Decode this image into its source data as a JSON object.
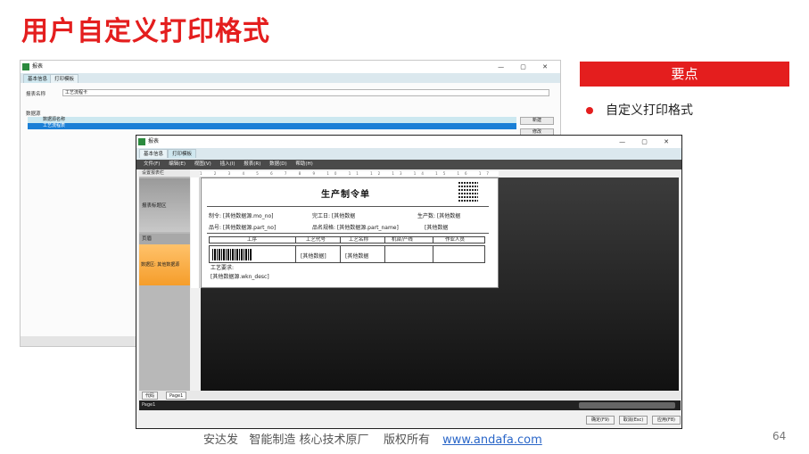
{
  "slide": {
    "title": "用户自定义打印格式",
    "key_points_header": "要点",
    "key_points": [
      "自定义打印格式"
    ],
    "footer": "安达发   智能制造 核心技术原厂    版权所有",
    "footer_link": "www.andafa.com",
    "page_number": "64"
  },
  "back_window": {
    "title": "报表",
    "tabs": [
      "基本信息",
      "打印模板"
    ],
    "report_name_label": "报表名称",
    "report_name_value": "工艺流程卡",
    "datasource_label": "数据源",
    "datasource_column": "数据源名称",
    "datasource_rows": [
      "工艺流程表"
    ],
    "buttons": [
      "新建",
      "修改"
    ]
  },
  "front_window": {
    "title": "报表",
    "tabs": [
      "基本信息",
      "打印模板"
    ],
    "menu": [
      "文件(F)",
      "编辑(E)",
      "视图(V)",
      "插入(I)",
      "报表(R)",
      "数据(D)",
      "帮助(H)"
    ],
    "left_panel": {
      "caption": "设置报表栏",
      "title_band": "报表标题区",
      "header_band": "页眉",
      "data_band": "数据区: 其他数据源"
    },
    "report": {
      "title": "生产制令单",
      "fields": {
        "order": "制令: [其他数据源.mo_no]",
        "finish_date": "完工日: [其他数据",
        "quantity": "生产数: [其他数据",
        "part_no": "品号: [其他数据源.part_no]",
        "part_name": "品名规格: [其他数据源.part_name]",
        "extra": "[其他数据"
      },
      "table_headers": [
        "工序",
        "工艺代号",
        "工艺名称",
        "机台/产线",
        "作业人员"
      ],
      "cell_1": "[其他数据]",
      "cell_2": "[其他数据",
      "requirement_label": "工艺要求:",
      "requirement_value": "[其他数据源.wkn_desc]"
    },
    "bottom_tabs": [
      "代码",
      "Page1"
    ],
    "status": "Page1",
    "buttons": [
      "确定(F9)",
      "取消(Esc)",
      "应用(F8)"
    ]
  }
}
